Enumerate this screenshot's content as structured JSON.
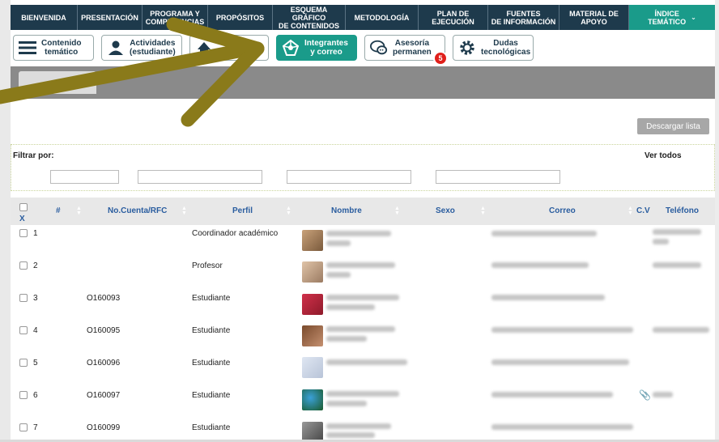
{
  "nav": {
    "items": [
      {
        "label": "BIENVENIDA"
      },
      {
        "label": "PRESENTACIÓN"
      },
      {
        "label": "PROGRAMA Y\nCOMPETENCIAS"
      },
      {
        "label": "PROPÓSITOS"
      },
      {
        "label": "ESQUEMA GRÁFICO\nDE CONTENIDOS"
      },
      {
        "label": "METODOLOGÍA"
      },
      {
        "label": "PLAN DE\nEJECUCIÓN"
      },
      {
        "label": "FUENTES\nDE INFORMACIÓN"
      },
      {
        "label": "MATERIAL DE\nAPOYO"
      },
      {
        "label": "ÍNDICE\nTEMÁTICO"
      }
    ],
    "active_color": "#1a9b8a",
    "bg_color": "#1e3a4c"
  },
  "toolbar": {
    "contenido": "Contenido\ntemático",
    "actividades": "Actividades\n(estudiante)",
    "integrantes": "Integrantes\ny correo",
    "asesoria": "Asesoría\npermanen",
    "dudas": "Dudas\ntecnológicas",
    "badge_count": "5"
  },
  "list": {
    "download_label": "Descargar lista",
    "filter_label": "Filtrar por:",
    "show_all_label": "Ver todos",
    "columns": {
      "select": "X",
      "num": "#",
      "account": "No.Cuenta/RFC",
      "profile": "Perfil",
      "name": "Nombre",
      "sex": "Sexo",
      "email": "Correo",
      "cv": "C.V",
      "phone": "Teléfono"
    },
    "rows": [
      {
        "num": "1",
        "account": "",
        "profile": "Coordinador académico"
      },
      {
        "num": "2",
        "account": "",
        "profile": "Profesor"
      },
      {
        "num": "3",
        "account": "O160093",
        "profile": "Estudiante"
      },
      {
        "num": "4",
        "account": "O160095",
        "profile": "Estudiante"
      },
      {
        "num": "5",
        "account": "O160096",
        "profile": "Estudiante"
      },
      {
        "num": "6",
        "account": "O160097",
        "profile": "Estudiante"
      },
      {
        "num": "7",
        "account": "O160099",
        "profile": "Estudiante"
      }
    ]
  }
}
